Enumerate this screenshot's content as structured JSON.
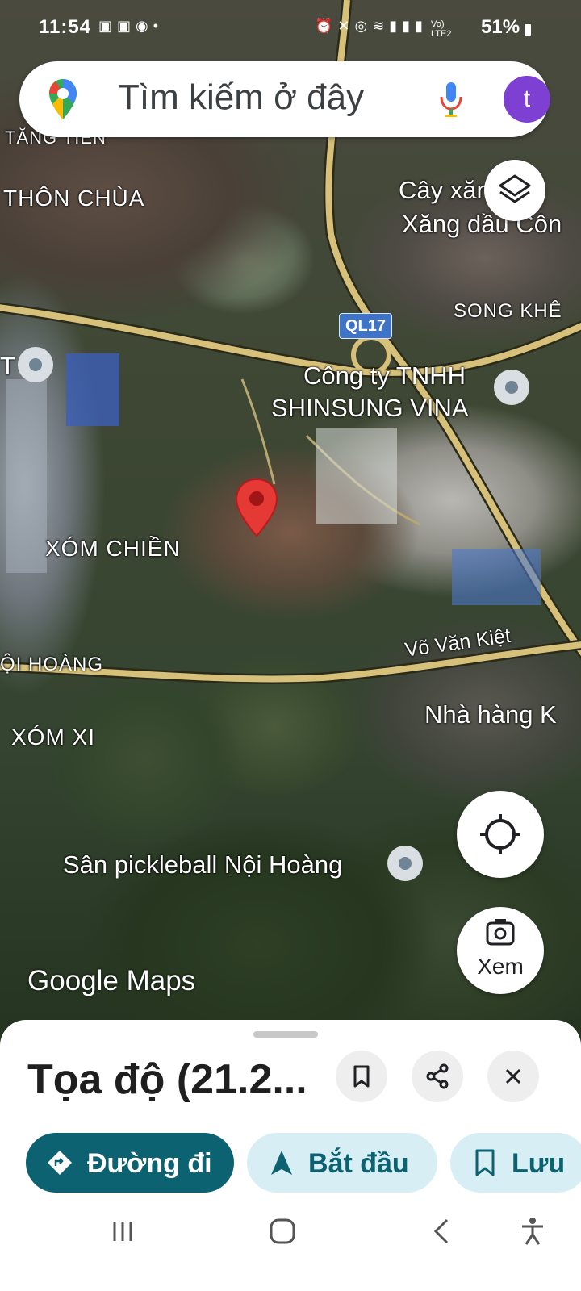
{
  "status_bar": {
    "time": "11:54",
    "battery": "51%",
    "network": "Vo) LTE2"
  },
  "search": {
    "placeholder": "Tìm kiếm ở đây",
    "avatar_letter": "t"
  },
  "map": {
    "labels": {
      "tang_tien": "TĂNG TIẾN",
      "thon_chua": "THÔN CHÙA",
      "cay_xang_1": "Cây xăng",
      "cay_xang_2": "Xăng dầu Côn",
      "song_khe": "SONG KHÊ",
      "ql17": "QL17",
      "company_1": "Công ty TNHH",
      "company_2": "SHINSUNG VINA",
      "xom_chien": "XÓM CHIỀN",
      "noi_hoang": "ỘI HOÀNG",
      "vo_van_kiet": "Võ Văn Kiệt",
      "nha_hang": "Nhà hàng K",
      "xom_xi": "XÓM XI",
      "pickleball": "Sân pickleball Nội Hoàng",
      "left_t": "T"
    },
    "logo": "Google Maps",
    "view_button": "Xem"
  },
  "sheet": {
    "title": "Tọa độ (21.2...",
    "directions": "Đường đi",
    "start": "Bắt đầu",
    "save": "Lưu"
  },
  "colors": {
    "directions_bg": "#0d6271",
    "pill_bg": "#d7eef5",
    "avatar": "#7e3fd3",
    "pin": "#e53935"
  }
}
